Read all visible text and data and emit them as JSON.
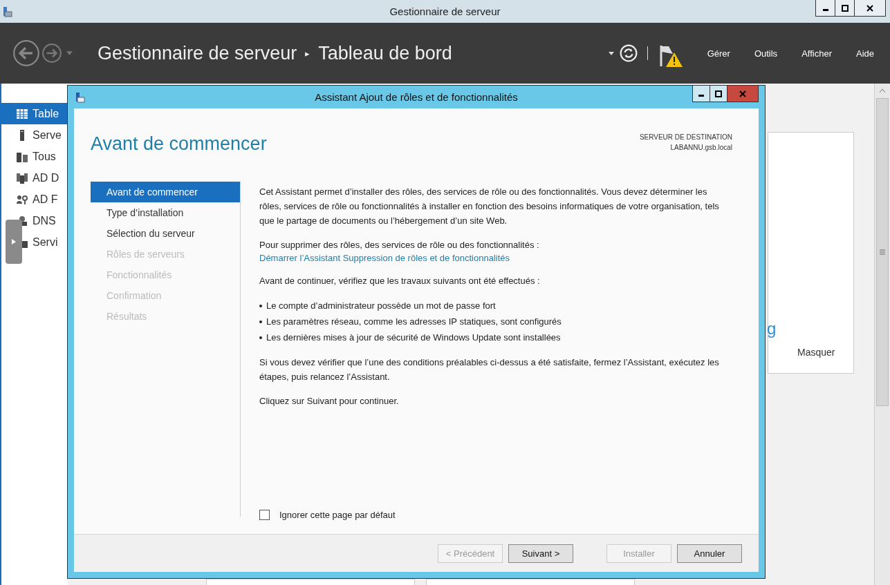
{
  "window": {
    "title": "Gestionnaire de serveur"
  },
  "header": {
    "breadcrumb": [
      "Gestionnaire de serveur",
      "Tableau de bord"
    ],
    "separator": "▸",
    "menu": [
      "Gérer",
      "Outils",
      "Afficher",
      "Aide"
    ]
  },
  "sidebar": {
    "items": [
      {
        "label": "Table",
        "selected": true
      },
      {
        "label": "Serve",
        "selected": false
      },
      {
        "label": "Tous",
        "selected": false
      },
      {
        "label": "AD D",
        "selected": false
      },
      {
        "label": "AD F",
        "selected": false
      },
      {
        "label": "DNS",
        "selected": false
      },
      {
        "label": "Servi",
        "selected": false
      }
    ]
  },
  "background_card": {
    "heading_fragment": "g",
    "link": "Masquer"
  },
  "dialog": {
    "title": "Assistant Ajout de rôles et de fonctionnalités",
    "heading": "Avant de commencer",
    "destination_label": "SERVEUR DE DESTINATION",
    "destination_server": "LABANNU.gsb.local",
    "steps": [
      {
        "label": "Avant de commencer",
        "selected": true,
        "disabled": false
      },
      {
        "label": "Type d’installation",
        "selected": false,
        "disabled": false
      },
      {
        "label": "Sélection du serveur",
        "selected": false,
        "disabled": false
      },
      {
        "label": "Rôles de serveurs",
        "selected": false,
        "disabled": true
      },
      {
        "label": "Fonctionnalités",
        "selected": false,
        "disabled": true
      },
      {
        "label": "Confirmation",
        "selected": false,
        "disabled": true
      },
      {
        "label": "Résultats",
        "selected": false,
        "disabled": true
      }
    ],
    "sections": [
      {
        "lines": [
          {
            "kind": "paragraph",
            "text": "Cet Assistant permet d’installer des rôles, des services de rôle ou des fonctionnalités. Vous devez déterminer les rôles, services de rôle ou fonctionnalités à installer en fonction des besoins informatiques de votre organisation, tels que le partage de documents ou l’hébergement d’un site Web."
          }
        ]
      },
      {
        "lines": [
          {
            "kind": "paragraph",
            "text": "Pour supprimer des rôles, des services de rôle ou des fonctionnalités :"
          },
          {
            "kind": "link",
            "text": "Démarrer l’Assistant Suppression de rôles et de fonctionnalités"
          }
        ]
      },
      {
        "lines": [
          {
            "kind": "paragraph",
            "text": "Avant de continuer, vérifiez que les travaux suivants ont été effectués :"
          }
        ]
      },
      {
        "lines": [
          {
            "kind": "bullet",
            "text": "Le compte d’administrateur possède un mot de passe fort"
          },
          {
            "kind": "bullet",
            "text": "Les paramètres réseau, comme les adresses IP statiques, sont configurés"
          },
          {
            "kind": "bullet",
            "text": "Les dernières mises à jour de sécurité de Windows Update sont installées"
          }
        ]
      },
      {
        "lines": [
          {
            "kind": "paragraph",
            "text": "Si vous devez vérifier que l’une des conditions préalables ci-dessus a été satisfaite, fermez l’Assistant, exécutez les étapes, puis relancez l’Assistant."
          }
        ]
      },
      {
        "lines": [
          {
            "kind": "paragraph",
            "text": "Cliquez sur Suivant pour continuer."
          }
        ]
      }
    ],
    "checkbox": {
      "label": "Ignorer cette page par défaut",
      "checked": false
    },
    "buttons": [
      {
        "label": "< Précédent",
        "disabled": true
      },
      {
        "label": "Suivant >",
        "disabled": false
      },
      {
        "label": "Installer",
        "disabled": true
      },
      {
        "label": "Annuler",
        "disabled": false
      }
    ]
  }
}
